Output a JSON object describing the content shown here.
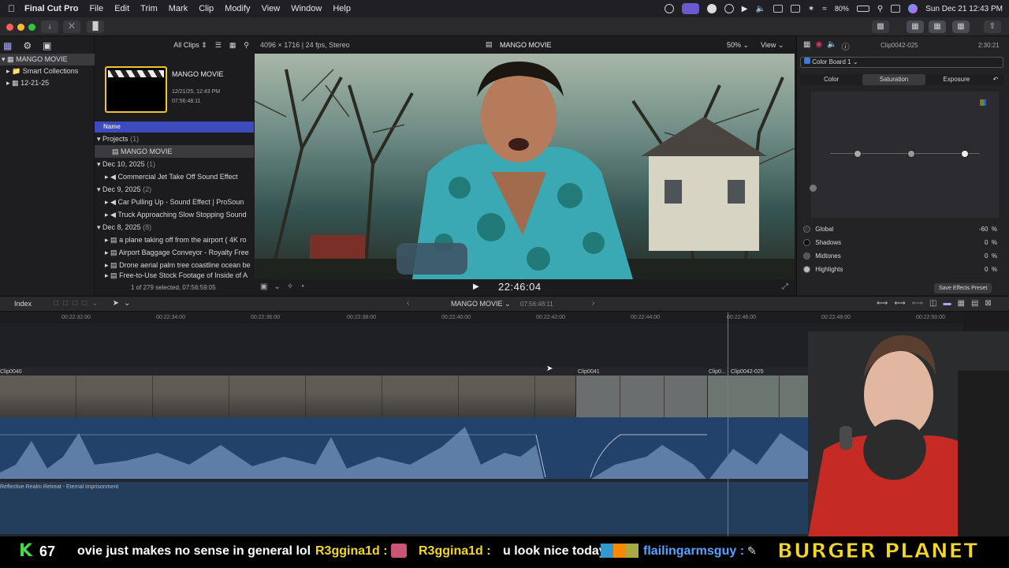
{
  "menubar": {
    "app_name": "Final Cut Pro",
    "menus": [
      "File",
      "Edit",
      "Trim",
      "Mark",
      "Clip",
      "Modify",
      "View",
      "Window",
      "Help"
    ],
    "battery": "80%",
    "datetime": "Sun Dec 21  12:43 PM"
  },
  "libraries": {
    "items": [
      {
        "label": "MANGO MOVIE",
        "icon": "library-icon",
        "selected": true
      },
      {
        "label": "Smart Collections",
        "icon": "folder-icon"
      },
      {
        "label": "12-21-25",
        "icon": "event-icon"
      }
    ]
  },
  "browser": {
    "filter": "All Clips",
    "project_title": "MANGO MOVIE",
    "project_date": "12/21/25, 12:43 PM",
    "project_duration": "07:56:48:11",
    "column_header": "Name",
    "rows": [
      {
        "type": "group",
        "label": "Projects",
        "count": "(1)"
      },
      {
        "type": "item",
        "label": "MANGO MOVIE",
        "selected": true
      },
      {
        "type": "group",
        "label": "Dec 10, 2025",
        "count": "(1)"
      },
      {
        "type": "item",
        "label": "Commercial Jet Take Off Sound Effect"
      },
      {
        "type": "group",
        "label": "Dec 9, 2025",
        "count": "(2)"
      },
      {
        "type": "item",
        "label": "Car Pulling Up - Sound Effect  |  ProSoun"
      },
      {
        "type": "item",
        "label": "Truck Approaching Slow Stopping Sound"
      },
      {
        "type": "group",
        "label": "Dec 8, 2025",
        "count": "(8)"
      },
      {
        "type": "item",
        "label": "a plane taking off from the airport ( 4K ro"
      },
      {
        "type": "item",
        "label": "Airport Baggage Conveyor - Royalty Free"
      },
      {
        "type": "item",
        "label": "Drone aerial palm tree coastline ocean be"
      },
      {
        "type": "item",
        "label": "Free-to-Use Stock Footage of Inside of A"
      }
    ],
    "status": "1 of 279 selected, 07:56:59:05"
  },
  "viewer": {
    "format": "4096 × 1716 | 24 fps, Stereo",
    "title": "MANGO MOVIE",
    "zoom": "50%",
    "view_label": "View",
    "timecode": "22:46:04"
  },
  "inspector": {
    "clip_name": "Clip0042-025",
    "duration": "2:30:21",
    "effect": "Color Board 1",
    "tabs": [
      "Color",
      "Saturation",
      "Exposure"
    ],
    "active_tab": "Saturation",
    "rows": [
      {
        "label": "Global",
        "value": "-60",
        "unit": "%"
      },
      {
        "label": "Shadows",
        "value": "0",
        "unit": "%"
      },
      {
        "label": "Midtones",
        "value": "0",
        "unit": "%"
      },
      {
        "label": "Highlights",
        "value": "0",
        "unit": "%"
      }
    ],
    "save_preset": "Save Effects Preset"
  },
  "timeline": {
    "index_label": "Index",
    "project": "MANGO MOVIE",
    "duration": "07:56:48:11",
    "ruler": [
      "00:22:32:00",
      "00:22:34:00",
      "00:22:36:00",
      "00:22:38:00",
      "00:22:40:00",
      "00:22:42:00",
      "00:22:44:00",
      "00:22:46:00",
      "00:22:48:00",
      "00:22:50:00"
    ],
    "clips": [
      "Clip0040",
      "Clip0041",
      "Clip0...",
      "Clip0042-025"
    ],
    "music_track": "Reflective Realm Retreat - Eternal imprisonment"
  },
  "ticker": {
    "counter": "67",
    "text1": "ovie just makes no sense in general lol",
    "user1": "R3ggina1d :",
    "user2": "R3ggina1d :",
    "msg2": "u look nice today",
    "user3": "flailingarmsguy :",
    "brand": "BURGER PLANET"
  },
  "colors": {
    "accent_blue": "#3e4bbd",
    "purple_link": "#a9a6ff",
    "playhead": "#e0513b",
    "ticker_yellow": "#f2d629",
    "ticker_green": "#49d64a"
  }
}
